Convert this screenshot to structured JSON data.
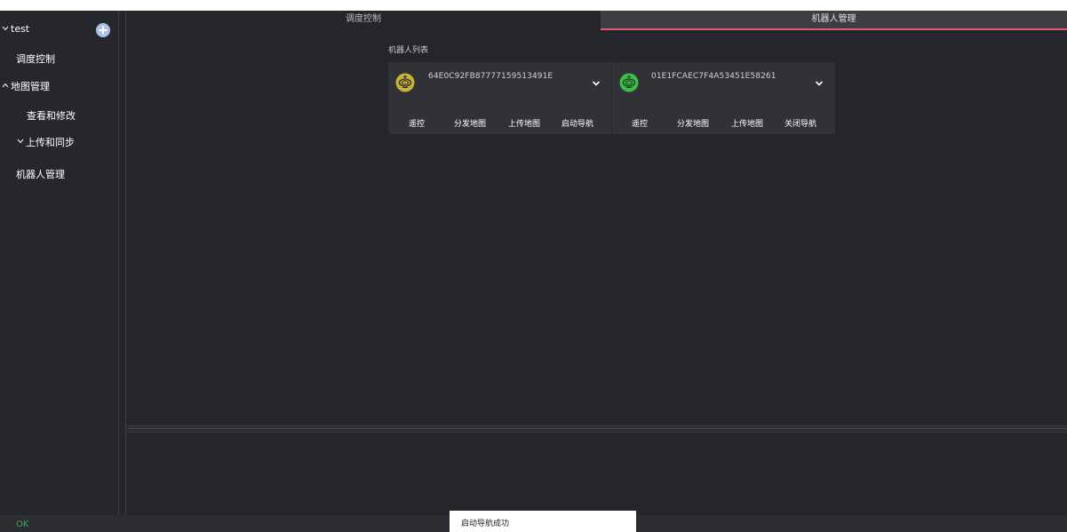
{
  "sidebar": {
    "project_name": "test",
    "items": [
      {
        "label": "调度控制"
      },
      {
        "label": "地图管理",
        "expanded": true
      },
      {
        "label": "查看和修改"
      },
      {
        "label": "上传和同步"
      },
      {
        "label": "机器人管理"
      }
    ]
  },
  "tabs": {
    "dispatch": "调度控制",
    "robot_management": "机器人管理",
    "active": "robot_management"
  },
  "main": {
    "section_title": "机器人列表",
    "robots": [
      {
        "id": "64E0C92FB87777159513491E",
        "status_color": "#c8b23a",
        "actions": [
          "遥控",
          "分发地图",
          "上传地图",
          "启动导航"
        ]
      },
      {
        "id": "01E1FCAEC7F4A53451E58261",
        "status_color": "#3cbf4a",
        "actions": [
          "遥控",
          "分发地图",
          "上传地图",
          "关闭导航"
        ]
      }
    ]
  },
  "statusbar": {
    "status_text": "OK",
    "toast_message": "启动导航成功"
  },
  "colors": {
    "accent_tab_underline": "#e05a7a",
    "ok_green": "#3aa655"
  }
}
